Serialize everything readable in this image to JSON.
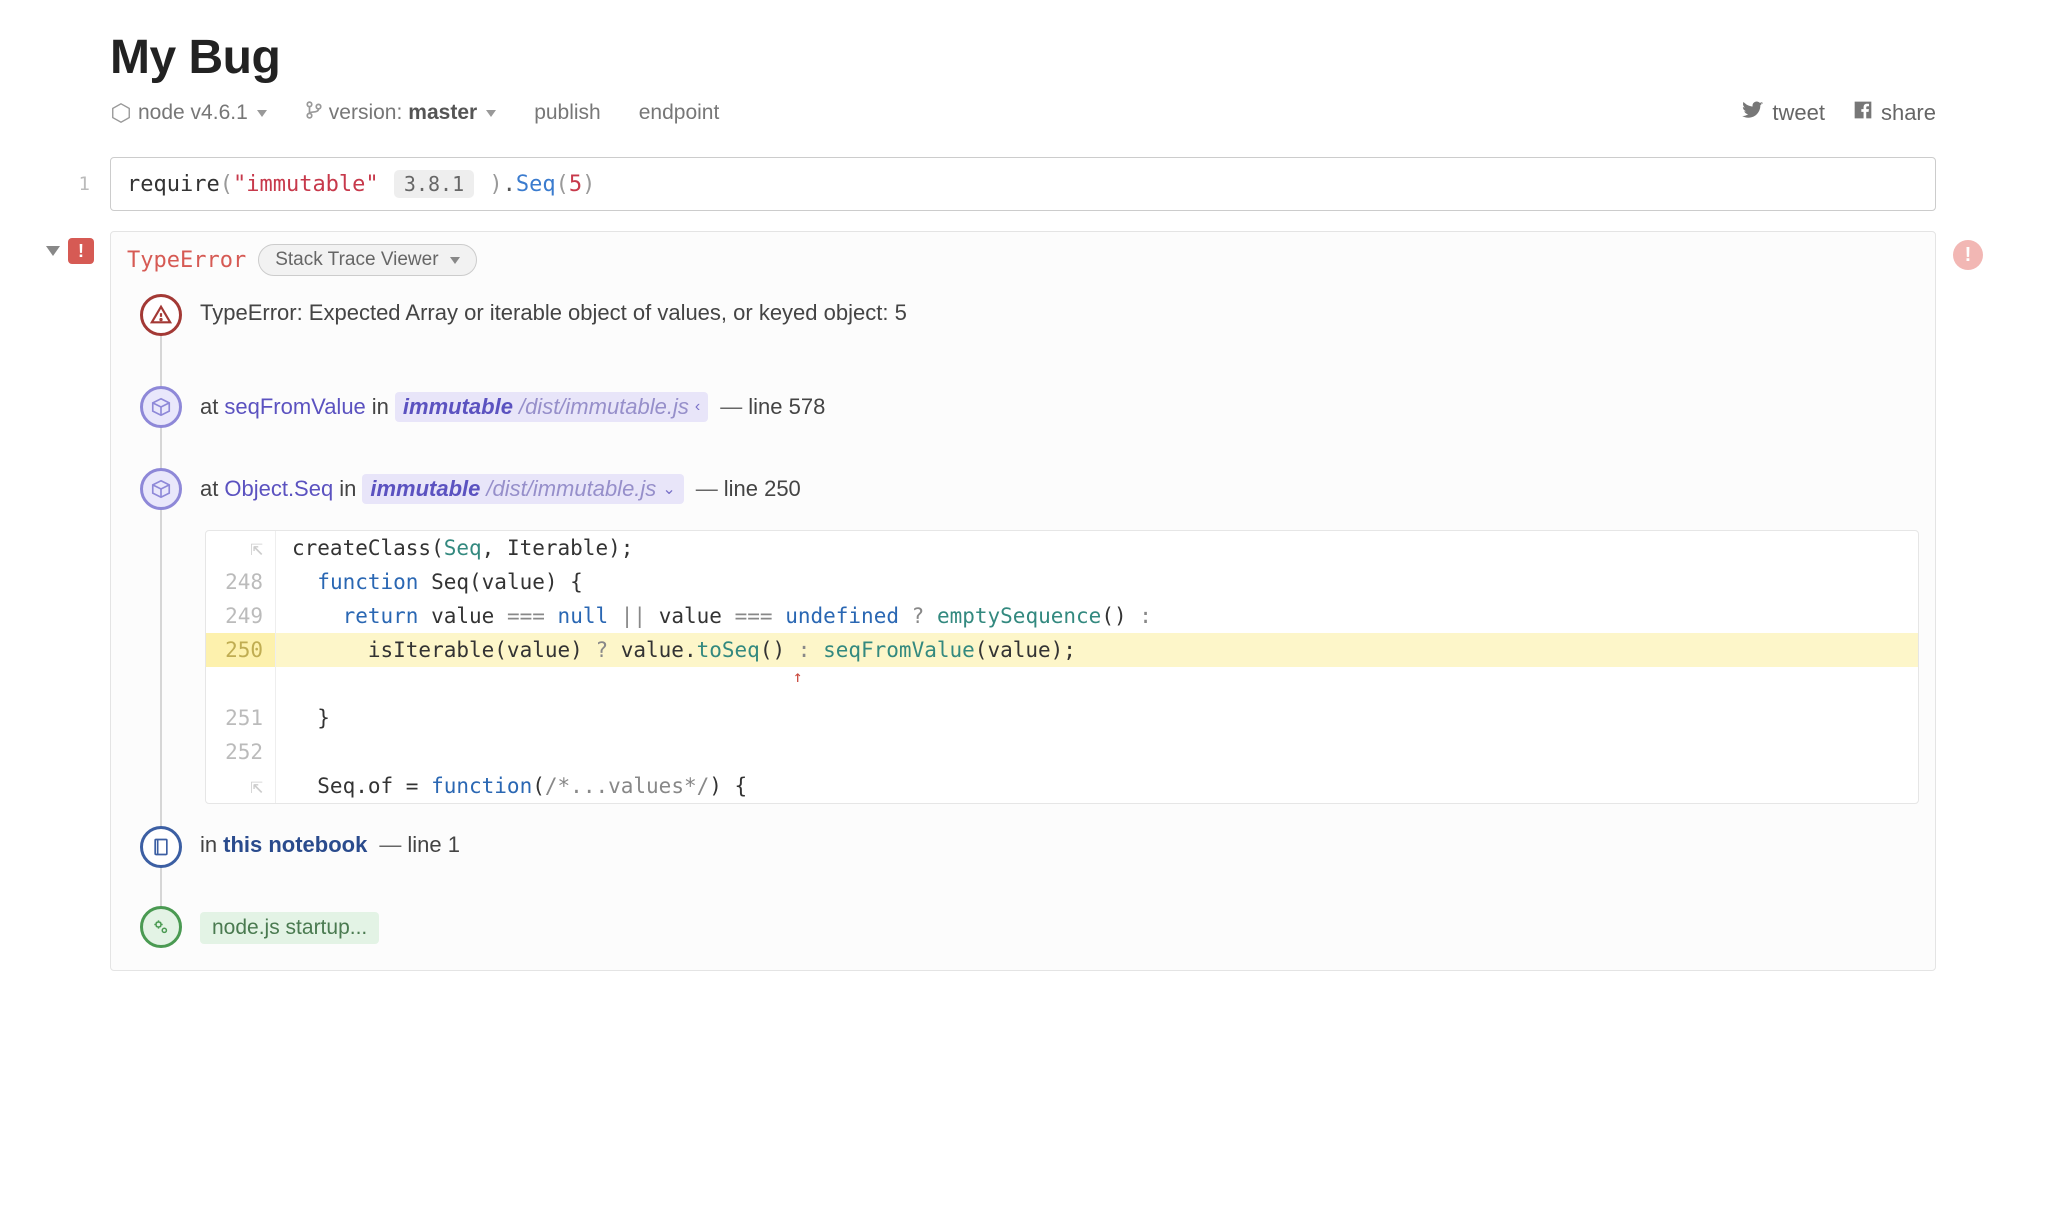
{
  "header": {
    "title": "My Bug",
    "node_item": {
      "label": "node v4.6.1"
    },
    "version_item": {
      "prefix": "version:",
      "value": "master"
    },
    "publish": "publish",
    "endpoint": "endpoint",
    "tweet": "tweet",
    "share": "share"
  },
  "input": {
    "line_number": "1",
    "require_fn": "require",
    "open_paren1": "(",
    "pkg_string": "\"immutable\"",
    "pkg_version": "3.8.1",
    "close_paren1": ")",
    "dot": ".",
    "method": "Seq",
    "open_paren2": "(",
    "arg": "5",
    "close_paren2": ")"
  },
  "output": {
    "error_type": "TypeError",
    "viewer_label": "Stack Trace Viewer",
    "error_message": "TypeError: Expected Array or iterable object of values, or keyed object: 5",
    "frames": [
      {
        "at": "at",
        "fn": "seqFromValue",
        "in": "in",
        "path_strong": "immutable",
        "path_rest": "/dist/immutable.js",
        "chevron": "‹",
        "dash": "—",
        "line_label": "line 578"
      },
      {
        "at": "at",
        "fn": "Object.Seq",
        "in": "in",
        "path_strong": "immutable",
        "path_rest": "/dist/immutable.js",
        "chevron": "⌄",
        "dash": "—",
        "line_label": "line 250"
      }
    ],
    "source": {
      "rows": [
        {
          "gutter_icon": true,
          "code_html": "createClass(<span class=\"fn2\">Seq</span>, Iterable);"
        },
        {
          "num": "248",
          "code_html": "  <span class=\"kw\">function</span> Seq(value) {"
        },
        {
          "num": "249",
          "code_html": "    <span class=\"kw\">return</span> value <span class=\"op\">===</span> <span class=\"lit\">null</span> <span class=\"op\">||</span> value <span class=\"op\">===</span> <span class=\"lit\">undefined</span> <span class=\"op\">?</span> <span class=\"mtd\">emptySequence</span>() <span class=\"op\">:</span>"
        },
        {
          "num": "250",
          "hl": true,
          "code_html": "      isIterable(value) <span class=\"op\">?</span> value.<span class=\"mtd\">toSeq</span>() <span class=\"op\">:</span> <span class=\"mtd\">seqFromValue</span>(value);"
        },
        {
          "arrow": true,
          "arrow_text": "                                                    ↑"
        },
        {
          "num": "251",
          "code_html": "  }"
        },
        {
          "num": "252",
          "code_html": ""
        },
        {
          "gutter_icon": true,
          "code_html": "  Seq.of = <span class=\"kw\">function</span>(<span class=\"cmt\">/*...values*/</span>) {"
        }
      ]
    },
    "notebook_frame": {
      "in": "in",
      "link": "this notebook",
      "dash": "—",
      "line_label": "line 1"
    },
    "node_frame": {
      "label": "node.js startup..."
    }
  }
}
